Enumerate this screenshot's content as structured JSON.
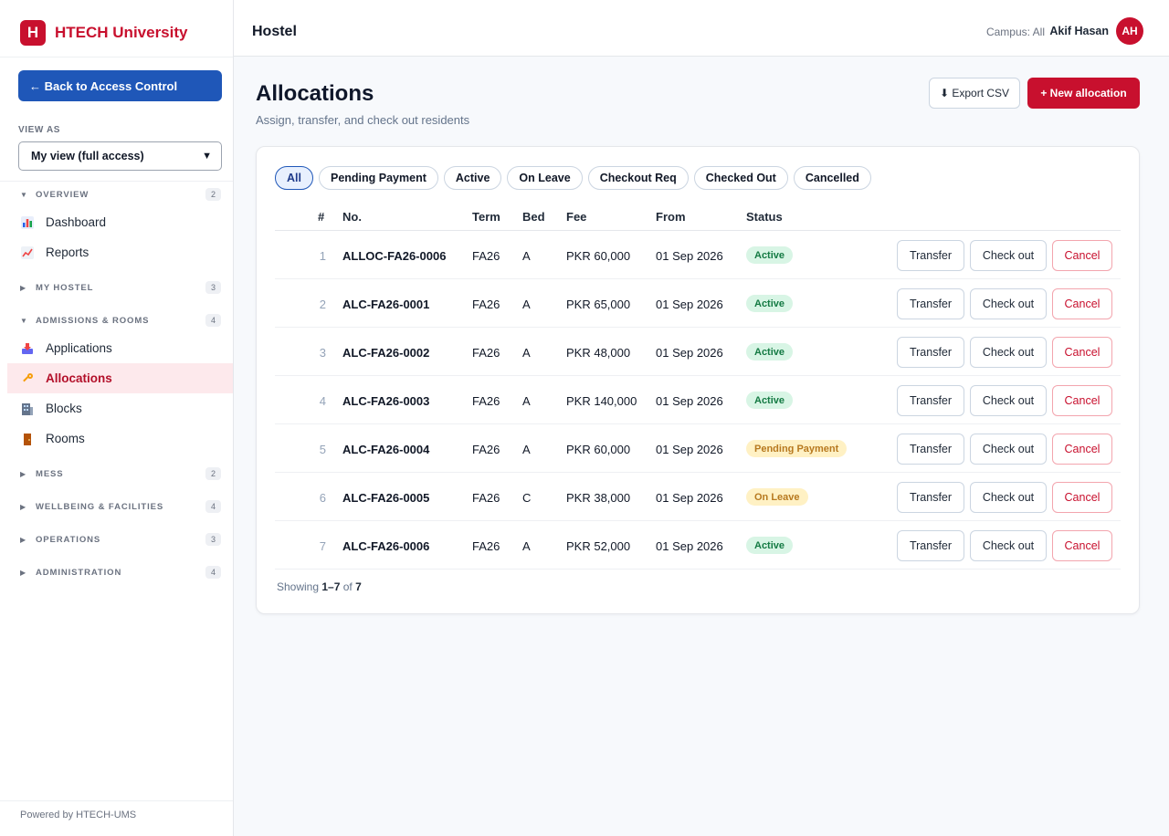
{
  "brand": {
    "logo_letter": "H",
    "name": "HTECH University"
  },
  "sidebar": {
    "back_label": "←  Back to Access Control",
    "view_as_label": "VIEW AS",
    "view_as_value": "My view (full access)",
    "sections": [
      {
        "label": "OVERVIEW",
        "count": "2",
        "expanded": true,
        "items": [
          {
            "label": "Dashboard",
            "icon": "bar-chart-icon"
          },
          {
            "label": "Reports",
            "icon": "line-chart-icon"
          }
        ]
      },
      {
        "label": "MY HOSTEL",
        "count": "3",
        "expanded": false,
        "items": []
      },
      {
        "label": "ADMISSIONS & ROOMS",
        "count": "4",
        "expanded": true,
        "items": [
          {
            "label": "Applications",
            "icon": "inbox-tray-icon"
          },
          {
            "label": "Allocations",
            "icon": "key-icon",
            "active": true
          },
          {
            "label": "Blocks",
            "icon": "building-icon"
          },
          {
            "label": "Rooms",
            "icon": "door-icon"
          }
        ]
      },
      {
        "label": "MESS",
        "count": "2",
        "expanded": false,
        "items": []
      },
      {
        "label": "WELLBEING & FACILITIES",
        "count": "4",
        "expanded": false,
        "items": []
      },
      {
        "label": "OPERATIONS",
        "count": "3",
        "expanded": false,
        "items": []
      },
      {
        "label": "ADMINISTRATION",
        "count": "4",
        "expanded": false,
        "items": []
      }
    ],
    "footer": "Powered by HTECH-UMS"
  },
  "topbar": {
    "title": "Hostel",
    "campus": "Campus: All",
    "user_name": "Akif Hasan",
    "avatar_initials": "AH"
  },
  "page": {
    "title": "Allocations",
    "subtitle": "Assign, transfer, and check out residents",
    "export_label": "⬇ Export CSV",
    "new_label": "+ New allocation"
  },
  "filters": [
    "All",
    "Pending Payment",
    "Active",
    "On Leave",
    "Checkout Req",
    "Checked Out",
    "Cancelled"
  ],
  "table": {
    "columns": {
      "idx": "#",
      "no": "No.",
      "term": "Term",
      "bed": "Bed",
      "fee": "Fee",
      "from": "From",
      "status": "Status"
    },
    "rows": [
      {
        "idx": "1",
        "no": "ALLOC-FA26-0006",
        "term": "FA26",
        "bed": "A",
        "fee": "PKR 60,000",
        "from": "01 Sep 2026",
        "status": "Active"
      },
      {
        "idx": "2",
        "no": "ALC-FA26-0001",
        "term": "FA26",
        "bed": "A",
        "fee": "PKR 65,000",
        "from": "01 Sep 2026",
        "status": "Active"
      },
      {
        "idx": "3",
        "no": "ALC-FA26-0002",
        "term": "FA26",
        "bed": "A",
        "fee": "PKR 48,000",
        "from": "01 Sep 2026",
        "status": "Active"
      },
      {
        "idx": "4",
        "no": "ALC-FA26-0003",
        "term": "FA26",
        "bed": "A",
        "fee": "PKR 140,000",
        "from": "01 Sep 2026",
        "status": "Active"
      },
      {
        "idx": "5",
        "no": "ALC-FA26-0004",
        "term": "FA26",
        "bed": "A",
        "fee": "PKR 60,000",
        "from": "01 Sep 2026",
        "status": "Pending Payment"
      },
      {
        "idx": "6",
        "no": "ALC-FA26-0005",
        "term": "FA26",
        "bed": "C",
        "fee": "PKR 38,000",
        "from": "01 Sep 2026",
        "status": "On Leave"
      },
      {
        "idx": "7",
        "no": "ALC-FA26-0006",
        "term": "FA26",
        "bed": "A",
        "fee": "PKR 52,000",
        "from": "01 Sep 2026",
        "status": "Active"
      }
    ],
    "actions": {
      "transfer": "Transfer",
      "checkout": "Check out",
      "cancel": "Cancel"
    }
  },
  "footer": {
    "prefix": "Showing ",
    "range": "1–7",
    "middle": " of ",
    "total": "7"
  },
  "colors": {
    "brand_red": "#c8102e",
    "primary_blue": "#1f57b8",
    "active_green": "#147a43",
    "pending_amber": "#b7791f"
  }
}
